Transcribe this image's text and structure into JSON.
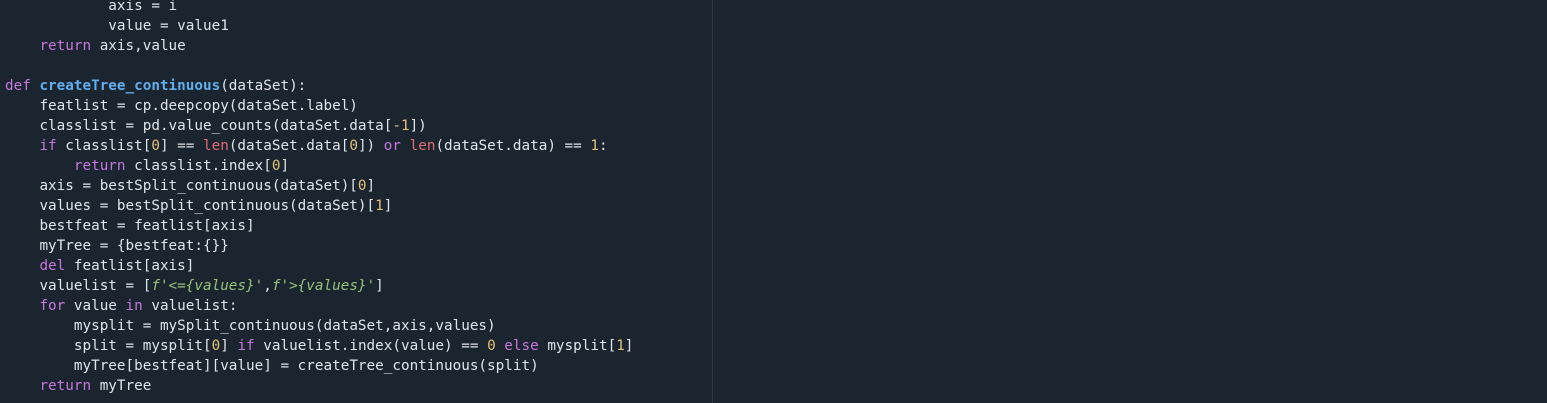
{
  "editor": {
    "colors": {
      "background": "#1b2530",
      "text": "#dfe4ea",
      "keyword": "#c678dd",
      "function": "#61afef",
      "builtin": "#e06c75",
      "number": "#e5c07b",
      "string": "#98c379"
    },
    "lines": [
      {
        "indent": "            ",
        "tokens": [
          {
            "t": "axis = i",
            "c": "plain"
          }
        ]
      },
      {
        "indent": "            ",
        "tokens": [
          {
            "t": "value = value1",
            "c": "plain"
          }
        ]
      },
      {
        "indent": "    ",
        "tokens": [
          {
            "t": "return",
            "c": "kw"
          },
          {
            "t": " axis,value",
            "c": "plain"
          }
        ]
      },
      {
        "indent": "",
        "tokens": []
      },
      {
        "indent": "",
        "tokens": [
          {
            "t": "def",
            "c": "kw"
          },
          {
            "t": " ",
            "c": "plain"
          },
          {
            "t": "createTree_continuous",
            "c": "fn"
          },
          {
            "t": "(dataSet):",
            "c": "plain"
          }
        ]
      },
      {
        "indent": "    ",
        "tokens": [
          {
            "t": "featlist = cp.deepcopy(dataSet.label)",
            "c": "plain"
          }
        ]
      },
      {
        "indent": "    ",
        "tokens": [
          {
            "t": "classlist = pd.value_counts(dataSet.data[",
            "c": "plain"
          },
          {
            "t": "-1",
            "c": "num"
          },
          {
            "t": "])",
            "c": "plain"
          }
        ]
      },
      {
        "indent": "    ",
        "tokens": [
          {
            "t": "if",
            "c": "kw"
          },
          {
            "t": " classlist[",
            "c": "plain"
          },
          {
            "t": "0",
            "c": "num"
          },
          {
            "t": "] == ",
            "c": "plain"
          },
          {
            "t": "len",
            "c": "builtin"
          },
          {
            "t": "(dataSet.data[",
            "c": "plain"
          },
          {
            "t": "0",
            "c": "num"
          },
          {
            "t": "]) ",
            "c": "plain"
          },
          {
            "t": "or",
            "c": "kw"
          },
          {
            "t": " ",
            "c": "plain"
          },
          {
            "t": "len",
            "c": "builtin"
          },
          {
            "t": "(dataSet.data) == ",
            "c": "plain"
          },
          {
            "t": "1",
            "c": "num"
          },
          {
            "t": ":",
            "c": "plain"
          }
        ]
      },
      {
        "indent": "        ",
        "tokens": [
          {
            "t": "return",
            "c": "kw"
          },
          {
            "t": " classlist.index[",
            "c": "plain"
          },
          {
            "t": "0",
            "c": "num"
          },
          {
            "t": "]",
            "c": "plain"
          }
        ]
      },
      {
        "indent": "    ",
        "tokens": [
          {
            "t": "axis = bestSplit_continuous(dataSet)[",
            "c": "plain"
          },
          {
            "t": "0",
            "c": "num"
          },
          {
            "t": "]",
            "c": "plain"
          }
        ]
      },
      {
        "indent": "    ",
        "tokens": [
          {
            "t": "values = bestSplit_continuous(dataSet)[",
            "c": "plain"
          },
          {
            "t": "1",
            "c": "num"
          },
          {
            "t": "]",
            "c": "plain"
          }
        ]
      },
      {
        "indent": "    ",
        "tokens": [
          {
            "t": "bestfeat = featlist[axis]",
            "c": "plain"
          }
        ]
      },
      {
        "indent": "    ",
        "tokens": [
          {
            "t": "myTree = {bestfeat:{}}",
            "c": "plain"
          }
        ]
      },
      {
        "indent": "    ",
        "tokens": [
          {
            "t": "del",
            "c": "kw"
          },
          {
            "t": " featlist[axis]",
            "c": "plain"
          }
        ]
      },
      {
        "indent": "    ",
        "tokens": [
          {
            "t": "valuelist = [",
            "c": "plain"
          },
          {
            "t": "f'<={values}'",
            "c": "str"
          },
          {
            "t": ",",
            "c": "plain"
          },
          {
            "t": "f'>{values}'",
            "c": "str"
          },
          {
            "t": "]",
            "c": "plain"
          }
        ]
      },
      {
        "indent": "    ",
        "tokens": [
          {
            "t": "for",
            "c": "kw"
          },
          {
            "t": " value ",
            "c": "plain"
          },
          {
            "t": "in",
            "c": "kw"
          },
          {
            "t": " valuelist:",
            "c": "plain"
          }
        ]
      },
      {
        "indent": "        ",
        "tokens": [
          {
            "t": "mysplit = mySplit_continuous(dataSet,axis,values)",
            "c": "plain"
          }
        ]
      },
      {
        "indent": "        ",
        "tokens": [
          {
            "t": "split = mysplit[",
            "c": "plain"
          },
          {
            "t": "0",
            "c": "num"
          },
          {
            "t": "] ",
            "c": "plain"
          },
          {
            "t": "if",
            "c": "kw"
          },
          {
            "t": " valuelist.index(value) == ",
            "c": "plain"
          },
          {
            "t": "0",
            "c": "num"
          },
          {
            "t": " ",
            "c": "plain"
          },
          {
            "t": "else",
            "c": "kw"
          },
          {
            "t": " mysplit[",
            "c": "plain"
          },
          {
            "t": "1",
            "c": "num"
          },
          {
            "t": "]",
            "c": "plain"
          }
        ]
      },
      {
        "indent": "        ",
        "tokens": [
          {
            "t": "myTree[bestfeat][value] = createTree_continuous(split)",
            "c": "plain"
          }
        ]
      },
      {
        "indent": "    ",
        "tokens": [
          {
            "t": "return",
            "c": "kw"
          },
          {
            "t": " myTree",
            "c": "plain"
          }
        ]
      }
    ]
  }
}
